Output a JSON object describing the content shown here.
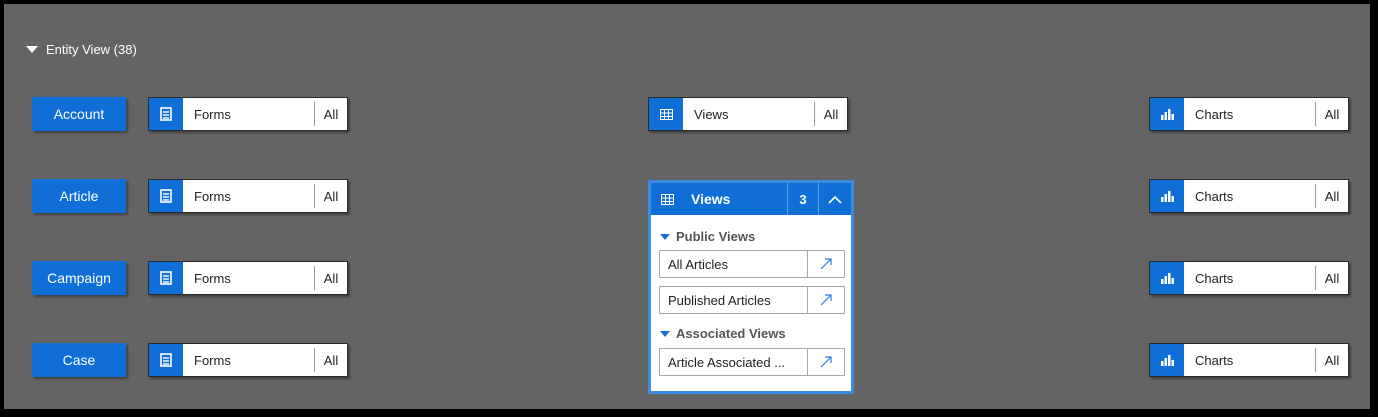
{
  "section": {
    "title": "Entity View (38)"
  },
  "tile_labels": {
    "forms": "Forms",
    "views": "Views",
    "charts": "Charts",
    "all": "All"
  },
  "entities": [
    {
      "name": "Account"
    },
    {
      "name": "Article"
    },
    {
      "name": "Campaign"
    },
    {
      "name": "Case"
    }
  ],
  "views_panel": {
    "title": "Views",
    "count": "3",
    "groups": [
      {
        "label": "Public Views",
        "items": [
          "All Articles",
          "Published Articles"
        ]
      },
      {
        "label": "Associated Views",
        "items": [
          "Article Associated ..."
        ]
      }
    ]
  },
  "icons": {
    "section_toggle": "caret-down-icon",
    "forms": "form-document-icon",
    "views": "grid-table-icon",
    "charts": "bar-chart-icon",
    "collapse": "chevron-up-icon",
    "open": "open-arrow-icon"
  },
  "colors": {
    "accent": "#0f6fd6",
    "canvas": "#646464",
    "panel_border": "#3b8ce0"
  }
}
